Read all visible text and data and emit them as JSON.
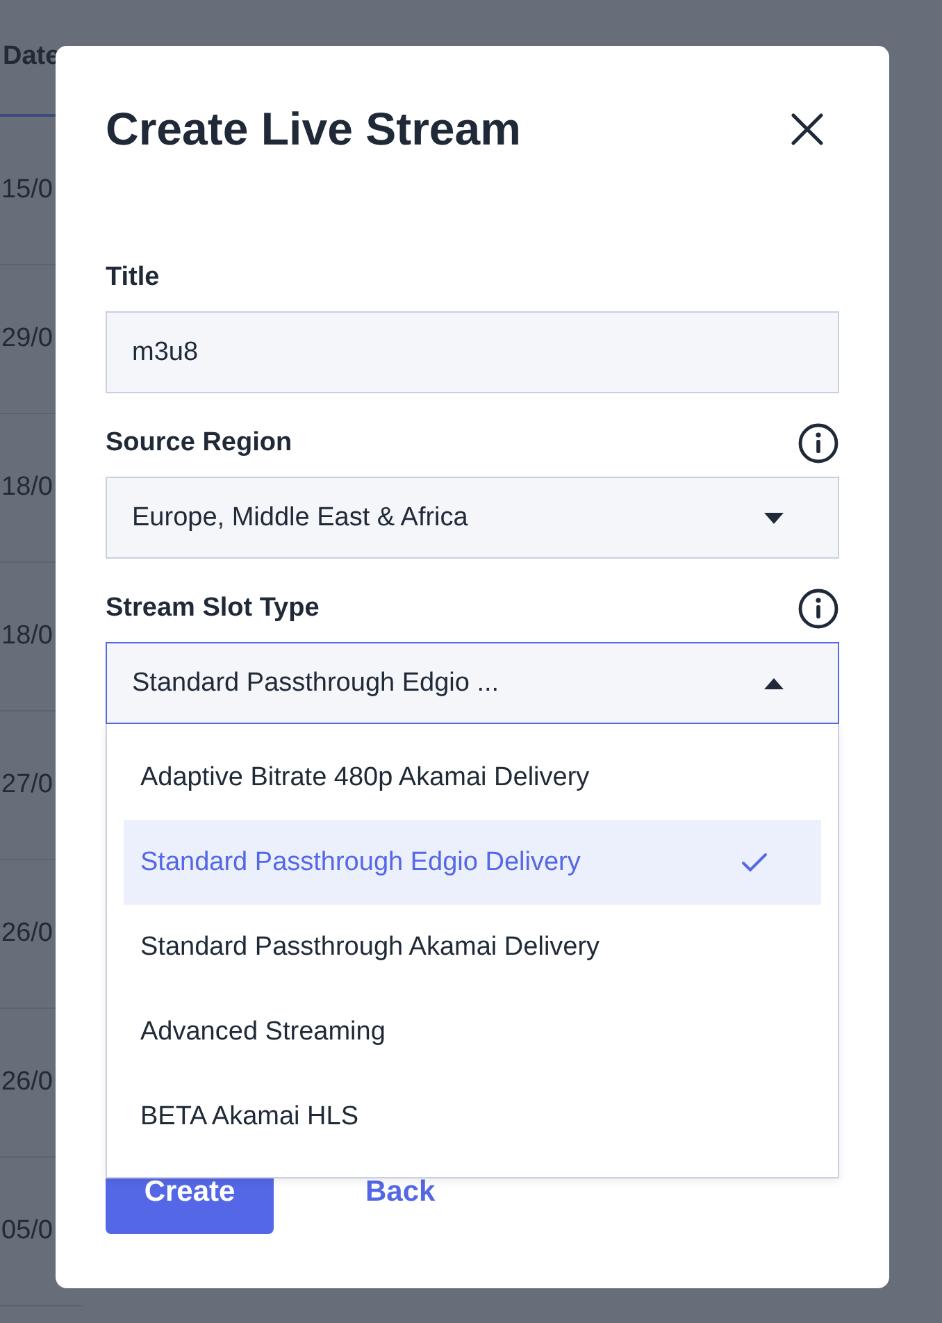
{
  "background_table": {
    "column_header": "Date",
    "rows": [
      "15/0",
      "29/0",
      "18/0",
      "18/0",
      "27/0",
      "26/0",
      "26/0",
      "05/0"
    ]
  },
  "dialog": {
    "title": "Create Live Stream",
    "fields": [
      {
        "kind": "text",
        "label": "Title",
        "info": false,
        "value": "m3u8"
      },
      {
        "kind": "select",
        "label": "Source Region",
        "info": true,
        "value": "Europe, Middle East & Africa",
        "expanded": false
      },
      {
        "kind": "select",
        "label": "Stream Slot Type",
        "info": true,
        "value": "Standard Passthrough Edgio ...",
        "expanded": true,
        "options": [
          {
            "label": "Adaptive Bitrate 480p Akamai Delivery",
            "selected": false
          },
          {
            "label": "Standard Passthrough Edgio Delivery",
            "selected": true
          },
          {
            "label": "Standard Passthrough Akamai Delivery",
            "selected": false
          },
          {
            "label": "Advanced Streaming",
            "selected": false
          },
          {
            "label": "BETA Akamai HLS",
            "selected": false
          }
        ]
      }
    ],
    "buttons": [
      {
        "kind": "primary",
        "label": "Create"
      },
      {
        "kind": "link",
        "label": "Back"
      }
    ]
  }
}
